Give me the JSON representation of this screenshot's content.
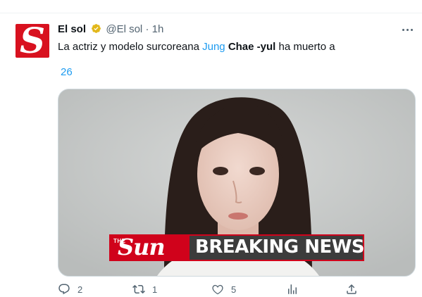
{
  "tweet": {
    "author_name": "El sol",
    "handle": "@El sol",
    "separator": "·",
    "time": "1h",
    "text_plain_1": "La actriz y modelo surcoreana ",
    "text_link": "Jung",
    "text_space": " ",
    "text_bold": "Chae -yul",
    "text_plain_2": " ha muerto a",
    "note_number": "26",
    "avatar_letter": "S"
  },
  "media": {
    "logo_the": "THE",
    "logo_sun": "Sun",
    "banner_text": "BREAKING NEWS"
  },
  "actions": {
    "reply_count": "2",
    "retweet_count": "1",
    "like_count": "5"
  },
  "colors": {
    "accent": "#1d9bf0",
    "verified": "#e2b719",
    "sun_red": "#d0021b",
    "avatar_red": "#d8111f"
  }
}
